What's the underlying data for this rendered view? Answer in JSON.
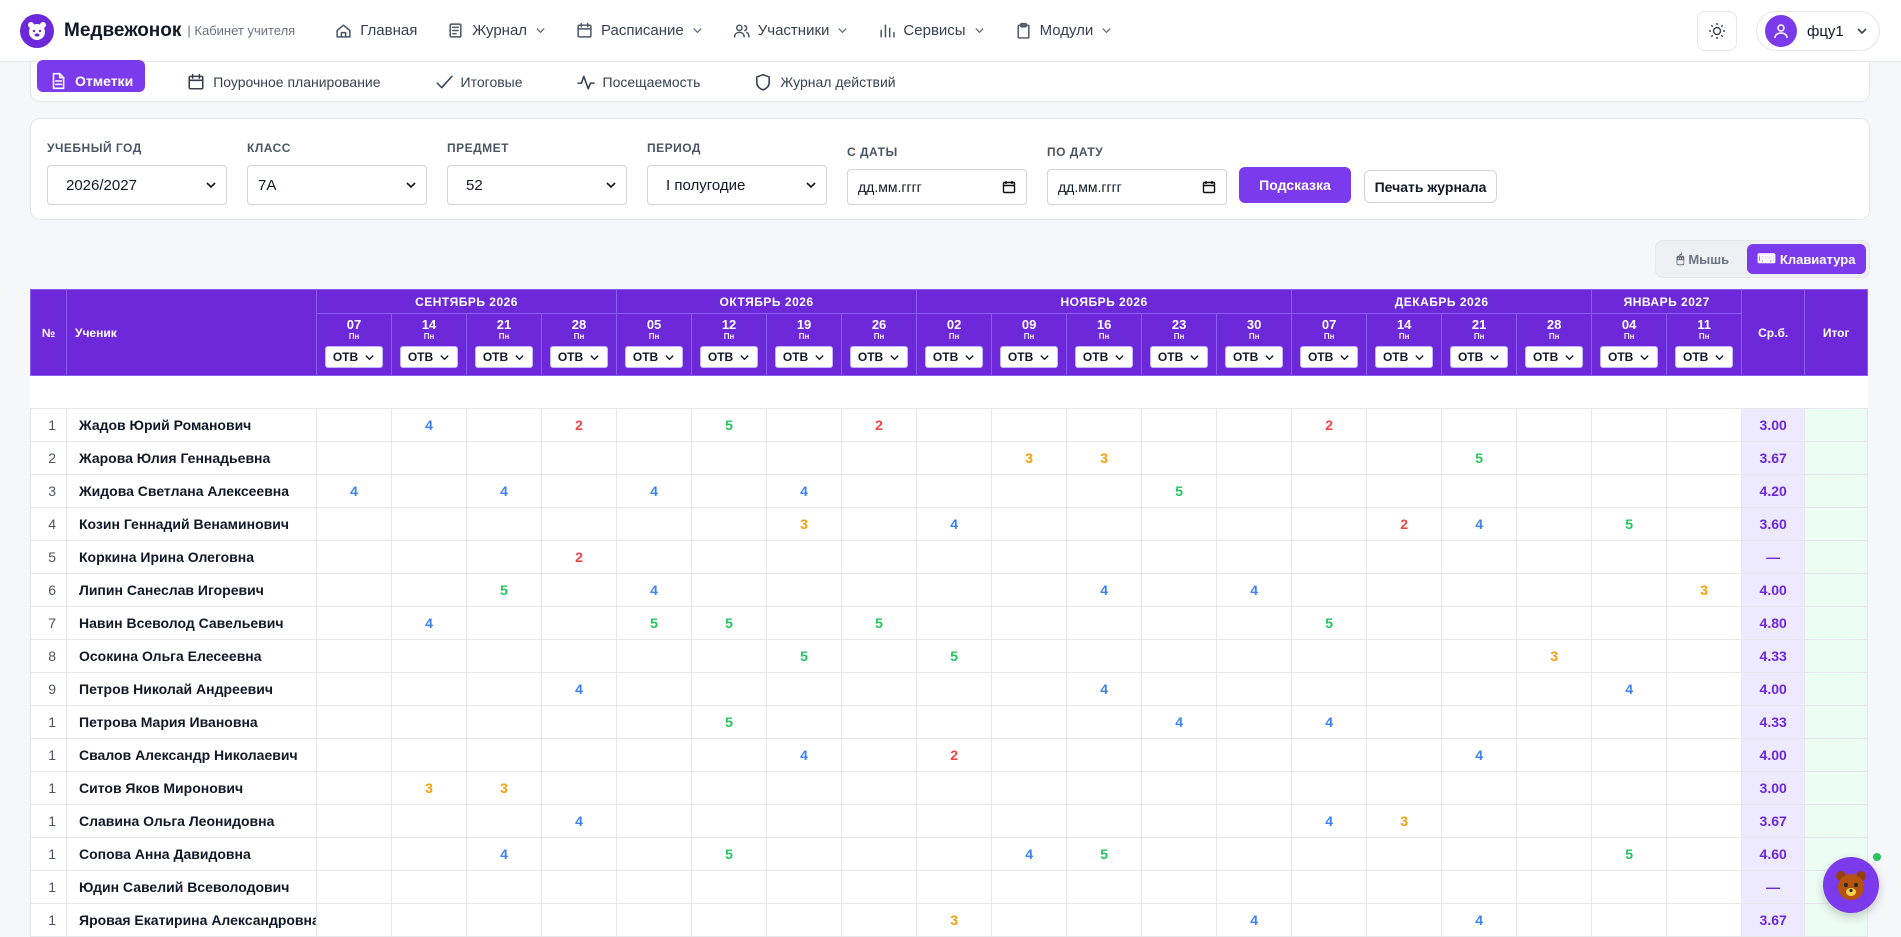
{
  "header": {
    "brand": "Медвежонок",
    "subtitle": "| Кабинет учителя",
    "nav": [
      {
        "label": "Главная",
        "icon": "home-icon",
        "dropdown": false
      },
      {
        "label": "Журнал",
        "icon": "journal-icon",
        "dropdown": true
      },
      {
        "label": "Расписание",
        "icon": "calendar-icon",
        "dropdown": true
      },
      {
        "label": "Участники",
        "icon": "users-icon",
        "dropdown": true
      },
      {
        "label": "Сервисы",
        "icon": "chart-icon",
        "dropdown": true
      },
      {
        "label": "Модули",
        "icon": "clipboard-icon",
        "dropdown": true
      }
    ],
    "user": "фцу1"
  },
  "tabs": [
    {
      "label": "Отметки",
      "icon": "document-icon",
      "active": true
    },
    {
      "label": "Поурочное планирование",
      "icon": "calendar-icon",
      "active": false
    },
    {
      "label": "Итоговые",
      "icon": "check-icon",
      "active": false
    },
    {
      "label": "Посещаемость",
      "icon": "activity-icon",
      "active": false
    },
    {
      "label": "Журнал действий",
      "icon": "shield-icon",
      "active": false
    }
  ],
  "filters": {
    "year_label": "УЧЕБНЫЙ ГОД",
    "year_value": "2026/2027",
    "class_label": "КЛАСС",
    "class_value": "7А",
    "subject_label": "ПРЕДМЕТ",
    "subject_value": "52",
    "period_label": "ПЕРИОД",
    "period_value": "I полугодие",
    "from_label": "С ДАТЫ",
    "from_placeholder": "дд.мм.гггг",
    "to_label": "ПО ДАТУ",
    "to_placeholder": "дд.мм.гггг",
    "hint_button": "Подсказка",
    "print_button": "Печать журнала"
  },
  "mode": {
    "mouse": "Мышь",
    "keyboard": "Клавиатура",
    "active": "keyboard"
  },
  "table": {
    "col_no": "№",
    "col_name": "Ученик",
    "col_avg": "Ср.б.",
    "col_final": "Итог",
    "mark_type": "ОТВ",
    "months": [
      {
        "label": "СЕНТЯБРЬ 2026",
        "span": 4
      },
      {
        "label": "ОКТЯБРЬ 2026",
        "span": 4
      },
      {
        "label": "НОЯБРЬ 2026",
        "span": 5
      },
      {
        "label": "ДЕКАБРЬ 2026",
        "span": 4
      },
      {
        "label": "ЯНВАРЬ 2027",
        "span": 2
      }
    ],
    "dates": [
      {
        "day": "07",
        "wd": "Пн"
      },
      {
        "day": "14",
        "wd": "Пн"
      },
      {
        "day": "21",
        "wd": "Пн"
      },
      {
        "day": "28",
        "wd": "Пн"
      },
      {
        "day": "05",
        "wd": "Пн"
      },
      {
        "day": "12",
        "wd": "Пн"
      },
      {
        "day": "19",
        "wd": "Пн"
      },
      {
        "day": "26",
        "wd": "Пн"
      },
      {
        "day": "02",
        "wd": "Пн"
      },
      {
        "day": "09",
        "wd": "Пн"
      },
      {
        "day": "16",
        "wd": "Пн"
      },
      {
        "day": "23",
        "wd": "Пн"
      },
      {
        "day": "30",
        "wd": "Пн"
      },
      {
        "day": "07",
        "wd": "Пн"
      },
      {
        "day": "14",
        "wd": "Пн"
      },
      {
        "day": "21",
        "wd": "Пн"
      },
      {
        "day": "28",
        "wd": "Пн"
      },
      {
        "day": "04",
        "wd": "Пн"
      },
      {
        "day": "11",
        "wd": "Пн"
      }
    ],
    "rows": [
      {
        "no": "1",
        "name": "Жадов Юрий Романович",
        "marks": [
          "",
          "4",
          "",
          "2",
          "",
          "5",
          "",
          "2",
          "",
          "",
          "",
          "",
          "",
          "2",
          "",
          "",
          "",
          "",
          ""
        ],
        "avg": "3.00"
      },
      {
        "no": "2",
        "name": "Жарова Юлия Геннадьевна",
        "marks": [
          "",
          "",
          "",
          "",
          "",
          "",
          "",
          "",
          "",
          "3",
          "3",
          "",
          "",
          "",
          "",
          "5",
          "",
          "",
          ""
        ],
        "avg": "3.67"
      },
      {
        "no": "3",
        "name": "Жидова Светлана Алексеевна",
        "marks": [
          "4",
          "",
          "4",
          "",
          "4",
          "",
          "4",
          "",
          "",
          "",
          "",
          "5",
          "",
          "",
          "",
          "",
          "",
          "",
          ""
        ],
        "avg": "4.20"
      },
      {
        "no": "4",
        "name": "Козин Геннадий Венаминович",
        "marks": [
          "",
          "",
          "",
          "",
          "",
          "",
          "3",
          "",
          "4",
          "",
          "",
          "",
          "",
          "",
          "2",
          "4",
          "",
          "5",
          ""
        ],
        "avg": "3.60"
      },
      {
        "no": "5",
        "name": "Коркина Ирина Олеговна",
        "marks": [
          "",
          "",
          "",
          "2",
          "",
          "",
          "",
          "",
          "",
          "",
          "",
          "",
          "",
          "",
          "",
          "",
          "",
          "",
          ""
        ],
        "avg": "—"
      },
      {
        "no": "6",
        "name": "Липин Санеслав Игоревич",
        "marks": [
          "",
          "",
          "5",
          "",
          "4",
          "",
          "",
          "",
          "",
          "",
          "4",
          "",
          "4",
          "",
          "",
          "",
          "",
          "",
          "3"
        ],
        "avg": "4.00"
      },
      {
        "no": "7",
        "name": "Навин Всеволод Савельевич",
        "marks": [
          "",
          "4",
          "",
          "",
          "5",
          "5",
          "",
          "5",
          "",
          "",
          "",
          "",
          "",
          "5",
          "",
          "",
          "",
          "",
          ""
        ],
        "avg": "4.80"
      },
      {
        "no": "8",
        "name": "Осокина Ольга Елесеевна",
        "marks": [
          "",
          "",
          "",
          "",
          "",
          "",
          "5",
          "",
          "5",
          "",
          "",
          "",
          "",
          "",
          "",
          "",
          "3",
          "",
          ""
        ],
        "avg": "4.33"
      },
      {
        "no": "9",
        "name": "Петров Николай Андреевич",
        "marks": [
          "",
          "",
          "",
          "4",
          "",
          "",
          "",
          "",
          "",
          "",
          "4",
          "",
          "",
          "",
          "",
          "",
          "",
          "4",
          ""
        ],
        "avg": "4.00"
      },
      {
        "no": "1",
        "name": "Петрова Мария Ивановна",
        "marks": [
          "",
          "",
          "",
          "",
          "",
          "5",
          "",
          "",
          "",
          "",
          "",
          "4",
          "",
          "4",
          "",
          "",
          "",
          "",
          ""
        ],
        "avg": "4.33"
      },
      {
        "no": "1",
        "name": "Свалов Александр Николаевич",
        "marks": [
          "",
          "",
          "",
          "",
          "",
          "",
          "4",
          "",
          "2",
          "",
          "",
          "",
          "",
          "",
          "",
          "4",
          "",
          "",
          ""
        ],
        "avg": "4.00"
      },
      {
        "no": "1",
        "name": "Ситов Яков Миронович",
        "marks": [
          "",
          "3",
          "3",
          "",
          "",
          "",
          "",
          "",
          "",
          "",
          "",
          "",
          "",
          "",
          "",
          "",
          "",
          "",
          ""
        ],
        "avg": "3.00"
      },
      {
        "no": "1",
        "name": "Славина Ольга Леонидовна",
        "marks": [
          "",
          "",
          "",
          "4",
          "",
          "",
          "",
          "",
          "",
          "",
          "",
          "",
          "",
          "4",
          "3",
          "",
          "",
          "",
          ""
        ],
        "avg": "3.67"
      },
      {
        "no": "1",
        "name": "Сопова Анна Давидовна",
        "marks": [
          "",
          "",
          "4",
          "",
          "",
          "5",
          "",
          "",
          "",
          "4",
          "5",
          "",
          "",
          "",
          "",
          "",
          "",
          "5",
          ""
        ],
        "avg": "4.60"
      },
      {
        "no": "1",
        "name": "Юдин Савелий Всеволодович",
        "marks": [
          "",
          "",
          "",
          "",
          "",
          "",
          "",
          "",
          "",
          "",
          "",
          "",
          "",
          "",
          "",
          "",
          "",
          "",
          ""
        ],
        "avg": "—"
      },
      {
        "no": "1",
        "name": "Яровая Екатирина Александровна",
        "marks": [
          "",
          "",
          "",
          "",
          "",
          "",
          "",
          "",
          "3",
          "",
          "",
          "",
          "4",
          "",
          "",
          "4",
          "",
          "",
          ""
        ],
        "avg": "3.67"
      }
    ]
  },
  "mark_colors": {
    "2": "#ef4444",
    "3": "#f59e0b",
    "4": "#3b82f6",
    "5": "#22c55e"
  },
  "accent": "#7c3aed"
}
